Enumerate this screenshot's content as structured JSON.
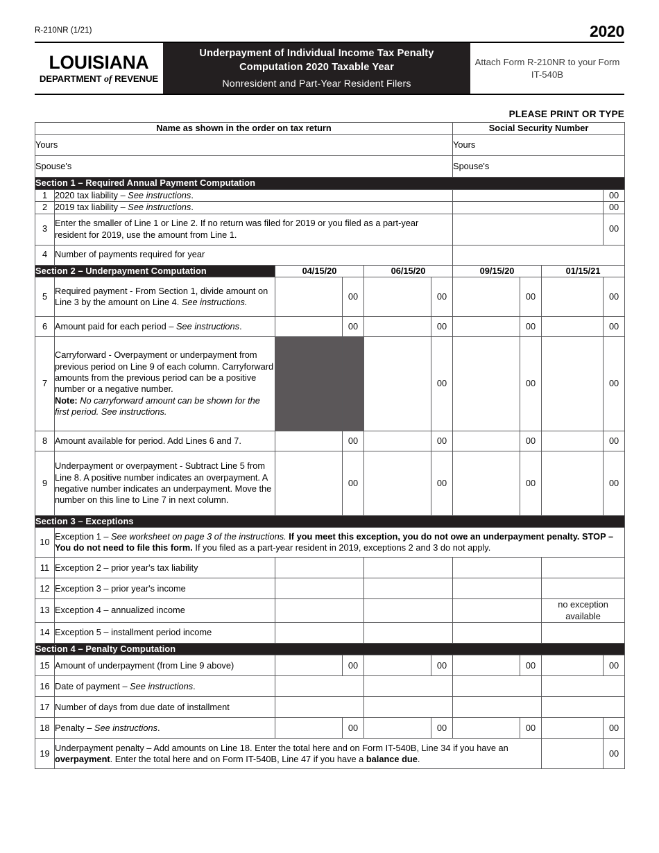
{
  "header": {
    "form_number": "R-210NR (1/21)",
    "year": "2020",
    "logo_state": "LOUISIANA",
    "logo_dept_1": "DEPARTMENT",
    "logo_dept_of": "of",
    "logo_dept_2": "REVENUE",
    "title_line1": "Underpayment of Individual Income Tax Penalty",
    "title_line2": "Computation 2020 Taxable Year",
    "subtitle": "Nonresident and Part-Year Resident Filers",
    "attach_note": "Attach Form R-210NR to your Form IT-540B",
    "please_print": "PLEASE PRINT OR TYPE"
  },
  "identity": {
    "name_header": "Name as shown in the order on tax return",
    "ssn_header": "Social Security Number",
    "yours_label": "Yours",
    "spouse_label": "Spouse's",
    "ssn_yours_label": "Yours",
    "ssn_spouse_label": "Spouse's"
  },
  "sections": {
    "s1": "Section 1 – Required Annual Payment Computation",
    "s2": "Section 2 – Underpayment Computation",
    "s3": "Section 3 – Exceptions",
    "s4": "Section 4 – Penalty Computation"
  },
  "periods": [
    "04/15/20",
    "06/15/20",
    "09/15/20",
    "01/15/21"
  ],
  "cents": "00",
  "no_exception": "no exception available",
  "lines": {
    "l1": {
      "num": "1",
      "text_a": "2020 tax liability – ",
      "text_i": "See instructions",
      "text_b": "."
    },
    "l2": {
      "num": "2",
      "text_a": "2019 tax liability – ",
      "text_i": "See instructions",
      "text_b": "."
    },
    "l3": {
      "num": "3",
      "text": "Enter the smaller of Line 1 or Line 2. If no return was filed for 2019 or you filed as a part-year resident for 2019, use the amount from Line 1."
    },
    "l4": {
      "num": "4",
      "text": "Number of payments required for year"
    },
    "l5": {
      "num": "5",
      "text_a": "Required payment - From Section 1, divide amount on Line 3 by the amount on Line 4. ",
      "text_i": "See instructions."
    },
    "l6": {
      "num": "6",
      "text_a": "Amount paid for each period – ",
      "text_i": "See instructions",
      "text_b": "."
    },
    "l7": {
      "num": "7",
      "text": "Carryforward - Overpayment or underpayment from previous period on Line 9 of each column. Carryforward amounts from the previous period can be a positive number or a negative number.",
      "note_label": "Note:",
      "note_text": " No carryforward amount can be shown for the first period. See instructions."
    },
    "l8": {
      "num": "8",
      "text": "Amount available for period. Add Lines 6 and 7."
    },
    "l9": {
      "num": "9",
      "text": "Underpayment or overpayment - Subtract Line 5 from Line 8. A positive number indicates an overpayment. A negative number indicates an underpayment. Move the number on this line to Line 7 in next column."
    },
    "l10": {
      "num": "10",
      "p1": "Exception 1 – ",
      "p2_i": "See worksheet on page 3 of the instructions.",
      "p3_b": " If you meet this exception, you do not owe an underpayment penalty. STOP – You do not need to file this form.",
      "p4": " If you filed as a part-year resident in 2019, exceptions 2 and 3 do not apply."
    },
    "l11": {
      "num": "11",
      "text": "Exception 2 – prior year's tax liability"
    },
    "l12": {
      "num": "12",
      "text": "Exception 3 – prior year's income"
    },
    "l13": {
      "num": "13",
      "text": "Exception 4 – annualized income"
    },
    "l14": {
      "num": "14",
      "text": "Exception 5 – installment period income"
    },
    "l15": {
      "num": "15",
      "text": "Amount of underpayment (from Line 9 above)"
    },
    "l16": {
      "num": "16",
      "text_a": "Date of payment – ",
      "text_i": "See instructions",
      "text_b": "."
    },
    "l17": {
      "num": "17",
      "text": "Number of days from due date of installment"
    },
    "l18": {
      "num": "18",
      "text_a": "Penalty – ",
      "text_i": "See instructions",
      "text_b": "."
    },
    "l19": {
      "num": "19",
      "p1": "Underpayment penalty – Add amounts on Line 18. Enter the total here and on Form IT-540B, Line 34 if you have an ",
      "p2_b": "overpayment",
      "p3": ". Enter the total here and on Form IT-540B, Line 47 if you have a ",
      "p4_b": "balance due",
      "p5": "."
    }
  },
  "colors": {
    "band_dark": "#231f20",
    "shade_gray": "#5b5759",
    "border": "#58585a"
  }
}
